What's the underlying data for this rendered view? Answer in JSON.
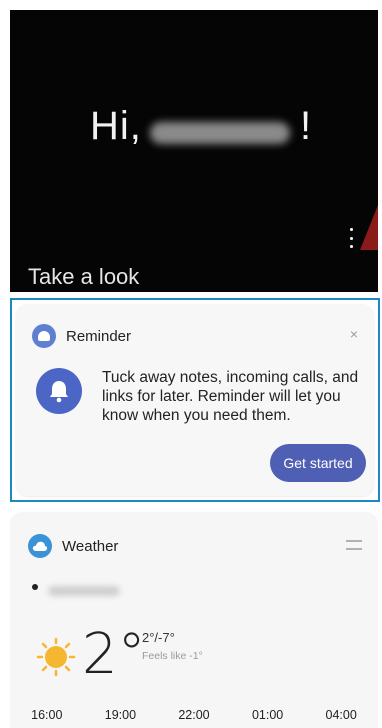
{
  "hero": {
    "greeting": "Hi,",
    "greeting_punct": "!",
    "section_label": "Take a look"
  },
  "reminder": {
    "title": "Reminder",
    "close_glyph": "×",
    "description": "Tuck away notes, incoming calls, and links for later. Reminder will let you know when you need them.",
    "button_label": "Get started",
    "accent_color": "#4e5fb4",
    "highlight_color": "#1e88c7"
  },
  "weather": {
    "title": "Weather",
    "temperature": "2°",
    "high_low": "2°/-7°",
    "feels_like": "Feels like -1°",
    "times": [
      "16:00",
      "19:00",
      "22:00",
      "01:00",
      "04:00"
    ]
  }
}
